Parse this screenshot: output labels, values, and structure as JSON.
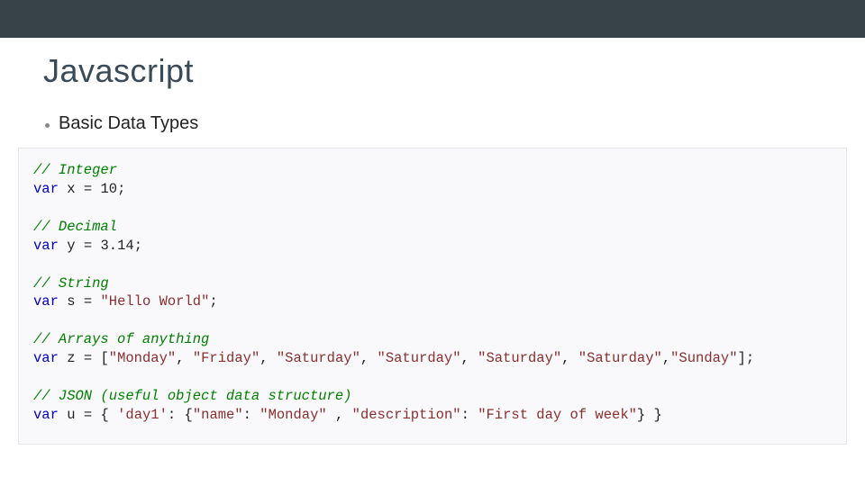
{
  "title": "Javascript",
  "bullet": "Basic Data Types",
  "code": {
    "kw": "var",
    "eq": "=",
    "semi": ";",
    "comma": ",",
    "lb": "[",
    "rb": "]",
    "lc": "{",
    "rc": "}",
    "colon": ":",
    "c1": "// Integer",
    "l1a": "x",
    "l1b": "10",
    "c2": "// Decimal",
    "l2a": "y",
    "l2b": "3.14",
    "c3": "// String",
    "l3a": "s",
    "l3b": "\"Hello World\"",
    "c4": "// Arrays of anything",
    "l4a": "z",
    "arr": [
      "\"Monday\"",
      "\"Friday\"",
      "\"Saturday\"",
      "\"Saturday\"",
      "\"Saturday\"",
      "\"Saturday\"",
      "\"Sunday\""
    ],
    "c5": "// JSON (useful object data structure)",
    "l5a": "u",
    "j1": "'day1'",
    "j2": "\"name\"",
    "j3": "\"Monday\"",
    "j4": "\"description\"",
    "j5": "\"First day of week\""
  }
}
